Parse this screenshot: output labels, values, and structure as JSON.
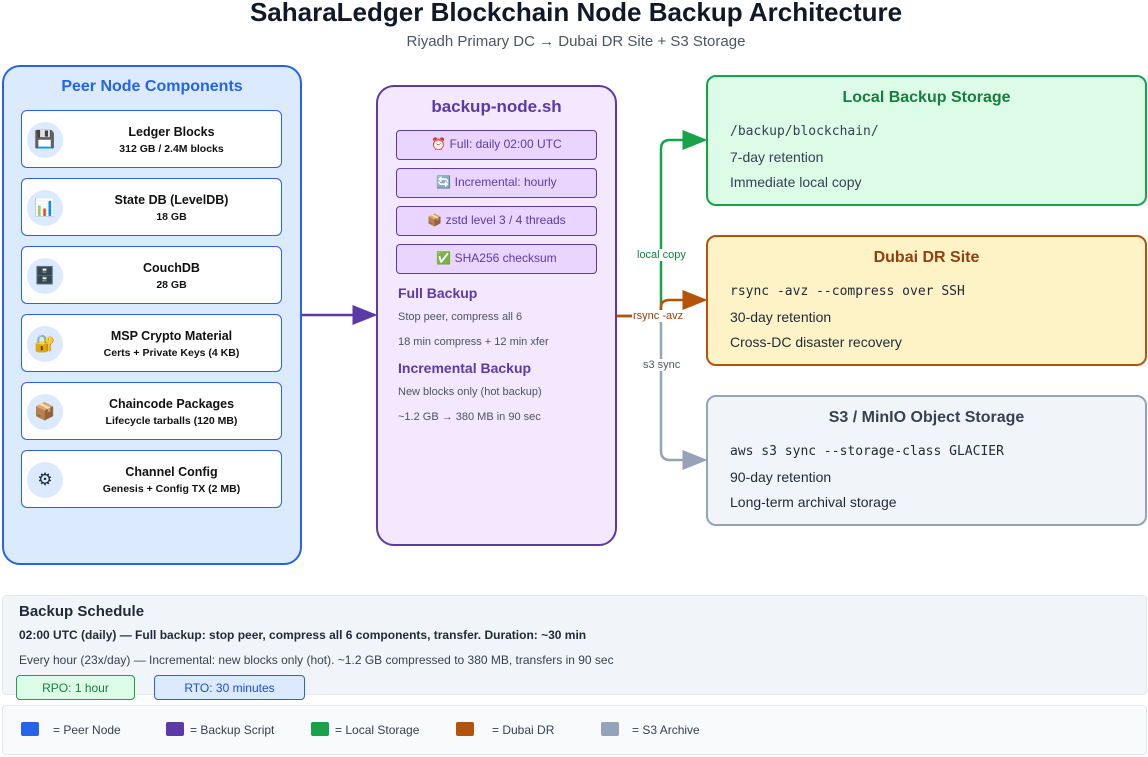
{
  "header": {
    "title": "SaharaLedger Blockchain Node Backup Architecture",
    "subtitle": "Riyadh Primary DC → Dubai DR Site + S3 Storage"
  },
  "peer": {
    "title": "Peer Node Components",
    "components": [
      {
        "name": "Ledger Blocks",
        "detail": "312 GB / 2.4M blocks",
        "icon": "floppy-disk-icon",
        "glyph": "💾"
      },
      {
        "name": "State DB (LevelDB)",
        "detail": "18 GB",
        "icon": "bar-chart-icon",
        "glyph": "📊"
      },
      {
        "name": "CouchDB",
        "detail": "28 GB",
        "icon": "file-cabinet-icon",
        "glyph": "🗄️"
      },
      {
        "name": "MSP Crypto Material",
        "detail": "Certs + Private Keys (4 KB)",
        "icon": "lock-key-icon",
        "glyph": "🔐"
      },
      {
        "name": "Chaincode Packages",
        "detail": "Lifecycle tarballs (120 MB)",
        "icon": "package-icon",
        "glyph": "📦"
      },
      {
        "name": "Channel Config",
        "detail": "Genesis + Config TX (2 MB)",
        "icon": "gear-icon",
        "glyph": "⚙"
      }
    ]
  },
  "script": {
    "title": "backup-node.sh",
    "pills": [
      {
        "text": "⏰ Full: daily 02:00 UTC",
        "icon": "alarm-clock-icon"
      },
      {
        "text": "🔄 Incremental: hourly",
        "icon": "refresh-icon"
      },
      {
        "text": "📦 zstd level 3 / 4 threads",
        "icon": "package-icon"
      },
      {
        "text": "✅ SHA256 checksum",
        "icon": "check-icon"
      }
    ],
    "full": {
      "heading": "Full Backup",
      "lines": [
        "Stop peer, compress all 6",
        "18 min compress + 12 min xfer"
      ]
    },
    "incremental": {
      "heading": "Incremental Backup",
      "lines": [
        "New blocks only (hot backup)",
        "~1.2 GB → 380 MB in 90 sec"
      ]
    }
  },
  "flows": {
    "local": "local copy",
    "rsync": "rsync -avz",
    "s3": "s3 sync"
  },
  "targets": {
    "local": {
      "title": "Local Backup Storage",
      "path": "/backup/blockchain/",
      "retention": "7-day retention",
      "note": "Immediate local copy"
    },
    "dr": {
      "title": "Dubai DR Site",
      "command": "rsync -avz --compress over SSH",
      "retention": "30-day retention",
      "note": "Cross-DC disaster recovery"
    },
    "s3": {
      "title": "S3 / MinIO Object Storage",
      "command": "aws s3 sync --storage-class GLACIER",
      "retention": "90-day retention",
      "note": "Long-term archival storage"
    }
  },
  "schedule": {
    "title": "Backup Schedule",
    "line1": "02:00 UTC (daily) — Full backup: stop peer, compress all 6 components, transfer. Duration: ~30 min",
    "line2": "Every hour (23x/day) — Incremental: new blocks only (hot). ~1.2 GB compressed to 380 MB, transfers in 90 sec",
    "rpo": "RPO: 1 hour",
    "rto": "RTO: 30 minutes"
  },
  "legend": [
    {
      "label": "= Peer Node",
      "color": "#2563eb"
    },
    {
      "label": "= Backup Script",
      "color": "#5b3aa8"
    },
    {
      "label": "= Local Storage",
      "color": "#16a34a"
    },
    {
      "label": "= Dubai DR",
      "color": "#b45309"
    },
    {
      "label": "= S3 Archive",
      "color": "#94a3b8"
    }
  ],
  "colors": {
    "peer": "#2563eb",
    "script": "#5b3aa8",
    "local": "#16a34a",
    "dr": "#b45309",
    "s3": "#94a3b8"
  }
}
